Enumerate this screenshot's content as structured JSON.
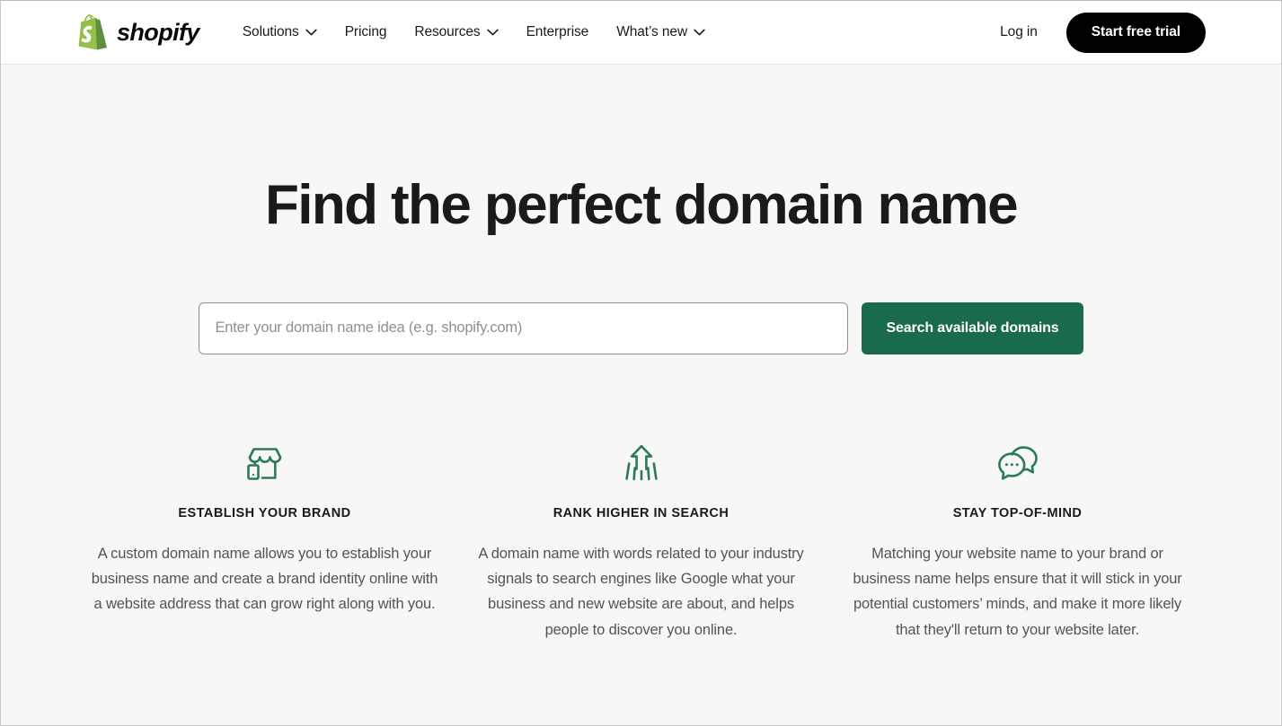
{
  "header": {
    "brand": {
      "name": "shopify",
      "logo_icon": "shopify-bag-icon",
      "logo_color": "#95BF47"
    },
    "nav": [
      {
        "label": "Solutions",
        "has_dropdown": true
      },
      {
        "label": "Pricing",
        "has_dropdown": false
      },
      {
        "label": "Resources",
        "has_dropdown": true
      },
      {
        "label": "Enterprise",
        "has_dropdown": false
      },
      {
        "label": "What’s new",
        "has_dropdown": true
      }
    ],
    "login_label": "Log in",
    "cta_label": "Start free trial"
  },
  "hero": {
    "title": "Find the perfect domain name",
    "search": {
      "placeholder": "Enter your domain name idea (e.g. shopify.com)",
      "value": "",
      "button_label": "Search available domains",
      "button_color": "#1a6b4a"
    }
  },
  "features": [
    {
      "icon": "storefront-icon",
      "title": "ESTABLISH YOUR BRAND",
      "body": "A custom domain name allows you to establish your business name and create a brand identity online with a website address that can grow right along with you."
    },
    {
      "icon": "rising-arrow-icon",
      "title": "RANK HIGHER IN SEARCH",
      "body": "A domain name with words related to your industry signals to search engines like Google what your business and new website are about, and helps people to discover you online."
    },
    {
      "icon": "chat-bubbles-icon",
      "title": "STAY TOP-OF-MIND",
      "body": "Matching your website name to your brand or business name helps ensure that it will stick in your potential customers’ minds, and make it more likely that they'll return to your website later."
    }
  ],
  "theme": {
    "page_background": "#f7f7f5",
    "header_background": "#ffffff",
    "icon_green": "#2a7a5b",
    "text_primary": "#1a1a1a",
    "text_muted": "#50555b"
  }
}
